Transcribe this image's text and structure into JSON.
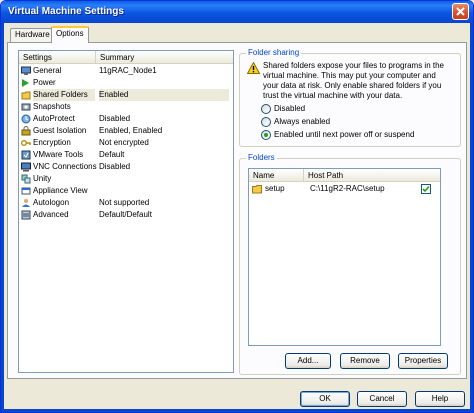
{
  "window": {
    "title": "Virtual Machine Settings"
  },
  "tabs": [
    {
      "label": "Hardware"
    },
    {
      "label": "Options"
    }
  ],
  "settings_list": {
    "columns": [
      "Settings",
      "Summary"
    ],
    "rows": [
      {
        "name": "General",
        "summary": "11gRAC_Node1",
        "icon": "general-icon"
      },
      {
        "name": "Power",
        "summary": "",
        "icon": "power-icon"
      },
      {
        "name": "Shared Folders",
        "summary": "Enabled",
        "icon": "shared-folders-icon"
      },
      {
        "name": "Snapshots",
        "summary": "",
        "icon": "snapshots-icon"
      },
      {
        "name": "AutoProtect",
        "summary": "Disabled",
        "icon": "autoprotect-icon"
      },
      {
        "name": "Guest Isolation",
        "summary": "Enabled, Enabled",
        "icon": "guest-isolation-icon"
      },
      {
        "name": "Encryption",
        "summary": "Not encrypted",
        "icon": "encryption-icon"
      },
      {
        "name": "VMware Tools",
        "summary": "Default",
        "icon": "vmware-tools-icon"
      },
      {
        "name": "VNC Connections",
        "summary": "Disabled",
        "icon": "vnc-icon"
      },
      {
        "name": "Unity",
        "summary": "",
        "icon": "unity-icon"
      },
      {
        "name": "Appliance View",
        "summary": "",
        "icon": "appliance-view-icon"
      },
      {
        "name": "Autologon",
        "summary": "Not supported",
        "icon": "autologon-icon"
      },
      {
        "name": "Advanced",
        "summary": "Default/Default",
        "icon": "advanced-icon"
      }
    ],
    "selected": "Shared Folders"
  },
  "folder_sharing": {
    "label": "Folder sharing",
    "warning_lines": [
      "Shared folders expose your files to programs in the",
      "virtual machine. This may put your computer and",
      "your data at risk. Only enable shared folders if you",
      "trust the virtual machine with your data."
    ],
    "options": [
      {
        "label": "Disabled",
        "selected": false
      },
      {
        "label": "Always enabled",
        "selected": false
      },
      {
        "label": "Enabled until next power off or suspend",
        "selected": true
      }
    ]
  },
  "folders": {
    "label": "Folders",
    "columns": [
      "Name",
      "Host Path"
    ],
    "rows": [
      {
        "name": "setup",
        "host_path": "C:\\11gR2-RAC\\setup",
        "enabled": true
      }
    ],
    "buttons": {
      "add": "Add...",
      "remove": "Remove",
      "properties": "Properties"
    }
  },
  "footer_buttons": {
    "ok": "OK",
    "cancel": "Cancel",
    "help": "Help"
  },
  "colors": {
    "titlebar": "#0846d0",
    "tab_accent": "#ffc83c",
    "group_label": "#0046d5",
    "radio_dot": "#21a121"
  }
}
